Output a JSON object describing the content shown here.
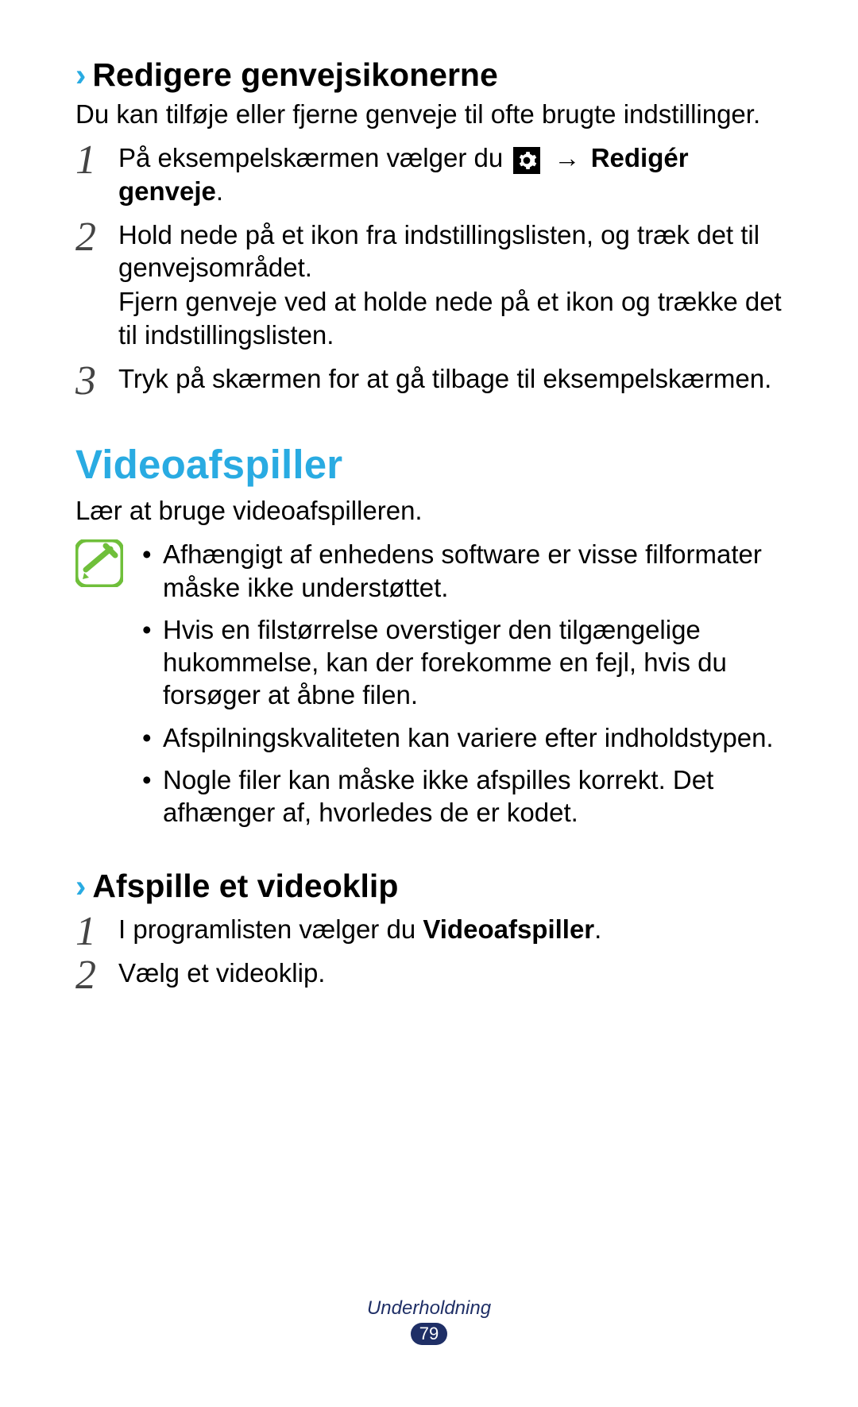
{
  "section1": {
    "heading": "Redigere genvejsikonerne",
    "intro": "Du kan tilføje eller fjerne genveje til ofte brugte indstillinger.",
    "steps": {
      "s1_pre": "På eksempelskærmen vælger du ",
      "s1_arrow": "→ ",
      "s1_bold": "Redigér genveje",
      "s1_post": ".",
      "s2a": "Hold nede på et ikon fra indstillingslisten, og træk det til genvejsområdet.",
      "s2b": "Fjern genveje ved at holde nede på et ikon og trække det til indstillingslisten.",
      "s3": "Tryk på skærmen for at gå tilbage til eksempelskærmen."
    }
  },
  "section2": {
    "title": "Videoafspiller",
    "intro": "Lær at bruge videoafspilleren.",
    "notes": [
      "Afhængigt af enhedens software er visse filformater måske ikke understøttet.",
      "Hvis en filstørrelse overstiger den tilgængelige hukommelse, kan der forekomme en fejl, hvis du forsøger at åbne filen.",
      "Afspilningskvaliteten kan variere efter indholdstypen.",
      "Nogle filer kan måske ikke afspilles korrekt. Det afhænger af, hvorledes de er kodet."
    ],
    "sub2": {
      "heading": "Afspille et videoklip",
      "steps": {
        "s1_pre": "I programlisten vælger du ",
        "s1_bold": "Videoafspiller",
        "s1_post": ".",
        "s2": "Vælg et videoklip."
      }
    }
  },
  "footer": {
    "label": "Underholdning",
    "page": "79"
  },
  "nums": {
    "n1": "1",
    "n2": "2",
    "n3": "3"
  }
}
